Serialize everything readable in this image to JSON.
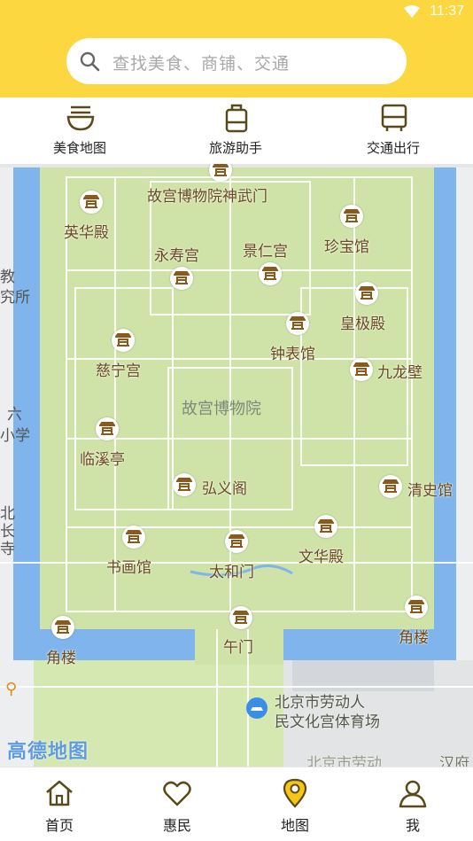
{
  "status_bar": {
    "time": "11:37"
  },
  "search": {
    "placeholder": "查找美食、商铺、交通",
    "icon": "search-icon"
  },
  "quick_tabs": [
    {
      "label": "美食地图",
      "icon": "bowl-icon"
    },
    {
      "label": "旅游助手",
      "icon": "luggage-icon"
    },
    {
      "label": "交通出行",
      "icon": "bus-icon"
    }
  ],
  "map": {
    "center_label": "故宫博物院",
    "pois": [
      {
        "label": "故宫博物院神武门"
      },
      {
        "label": "英华殿"
      },
      {
        "label": "珍宝馆"
      },
      {
        "label": "永寿宫"
      },
      {
        "label": "景仁宫"
      },
      {
        "label": "皇极殿"
      },
      {
        "label": "钟表馆"
      },
      {
        "label": "慈宁宫"
      },
      {
        "label": "九龙壁"
      },
      {
        "label": "临溪亭"
      },
      {
        "label": "弘义阁"
      },
      {
        "label": "清史馆"
      },
      {
        "label": "书画馆"
      },
      {
        "label": "文华殿"
      },
      {
        "label": "太和门"
      },
      {
        "label": "角楼"
      },
      {
        "label": "午门"
      },
      {
        "label": "角楼"
      }
    ],
    "edge_labels": [
      "教",
      "究所",
      "六",
      "小学",
      "北",
      "长",
      "寺"
    ],
    "venue_label_line1": "北京市劳动人",
    "venue_label_line2": "民文化宫体育场",
    "bottom_fragment_1": "北京市劳动",
    "bottom_fragment_2": "汉府",
    "logo": "高德地图"
  },
  "nav": [
    {
      "label": "首页",
      "icon": "home-icon"
    },
    {
      "label": "惠民",
      "icon": "heart-icon"
    },
    {
      "label": "地图",
      "icon": "map-pin-icon",
      "active": true
    },
    {
      "label": "我",
      "icon": "person-icon"
    }
  ],
  "colors": {
    "header": "#fcd740",
    "map_green": "#cfe3a8",
    "moat": "#7fb4ec",
    "poi_label": "#6b4a25",
    "active_icon": "#f5c518"
  }
}
